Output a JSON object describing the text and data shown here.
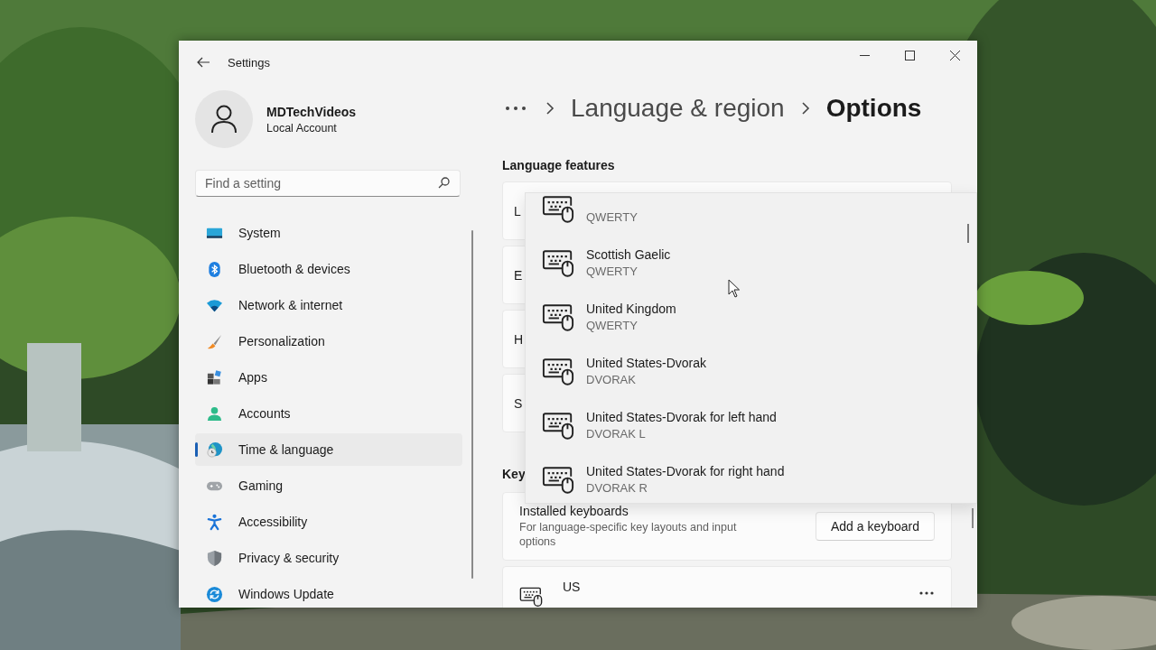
{
  "window": {
    "title": "Settings"
  },
  "account": {
    "name": "MDTechVideos",
    "type": "Local Account"
  },
  "search": {
    "placeholder": "Find a setting"
  },
  "nav": [
    {
      "label": "System",
      "selected": false
    },
    {
      "label": "Bluetooth & devices",
      "selected": false
    },
    {
      "label": "Network & internet",
      "selected": false
    },
    {
      "label": "Personalization",
      "selected": false
    },
    {
      "label": "Apps",
      "selected": false
    },
    {
      "label": "Accounts",
      "selected": false
    },
    {
      "label": "Time & language",
      "selected": true
    },
    {
      "label": "Gaming",
      "selected": false
    },
    {
      "label": "Accessibility",
      "selected": false
    },
    {
      "label": "Privacy & security",
      "selected": false
    },
    {
      "label": "Windows Update",
      "selected": false
    }
  ],
  "breadcrumb": [
    {
      "label": "Language & region",
      "selected": false
    },
    {
      "label": "Options",
      "selected": true
    }
  ],
  "language_features": {
    "heading": "Language features",
    "cards": [
      {
        "label": "L"
      },
      {
        "label": "E"
      },
      {
        "label": "H"
      },
      {
        "label": "S"
      }
    ]
  },
  "keyboards": {
    "heading": "Key",
    "installed": {
      "title": "Installed keyboards",
      "description": "For language-specific key layouts and input options",
      "button": "Add a keyboard"
    },
    "items": [
      {
        "name": "US"
      }
    ]
  },
  "popup": {
    "items": [
      {
        "layout": "QWERTY"
      },
      {
        "name": "Scottish Gaelic",
        "layout": "QWERTY"
      },
      {
        "name": "United Kingdom",
        "layout": "QWERTY"
      },
      {
        "name": "United States-Dvorak",
        "layout": "DVORAK"
      },
      {
        "name": "United States-Dvorak for left hand",
        "layout": "DVORAK L"
      },
      {
        "name": "United States-Dvorak for right hand",
        "layout": "DVORAK R"
      }
    ]
  }
}
